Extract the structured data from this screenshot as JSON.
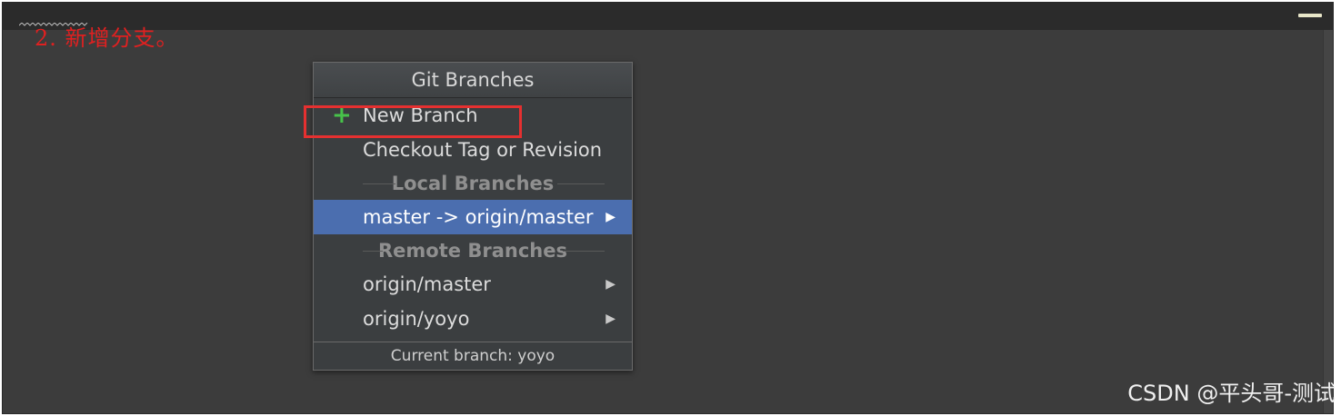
{
  "annotation": "2. 新增分支。",
  "popup": {
    "title": "Git Branches",
    "actions": [
      {
        "label": "New Branch",
        "icon": "plus-icon"
      },
      {
        "label": "Checkout Tag or Revision"
      }
    ],
    "local_header": "Local Branches",
    "local_branches": [
      {
        "label": "master -> origin/master",
        "selected": true
      }
    ],
    "remote_header": "Remote Branches",
    "remote_branches": [
      {
        "label": "origin/master"
      },
      {
        "label": "origin/yoyo"
      }
    ],
    "footer": "Current branch: yoyo"
  },
  "watermark": "CSDN @平头哥-测试",
  "colors": {
    "annotation": "#e02020",
    "highlight_box": "#e53030",
    "selected_row": "#4b6eaf",
    "plus_icon": "#47c24a"
  }
}
